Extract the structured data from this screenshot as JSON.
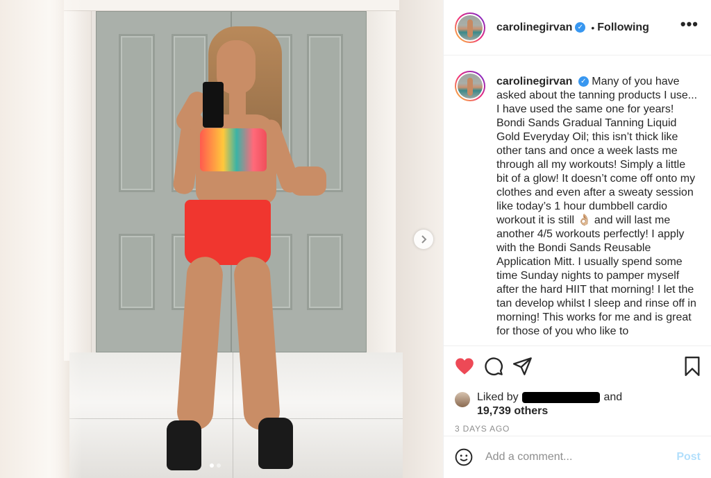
{
  "post": {
    "username": "carolinegirvan",
    "follow_sep": "•",
    "follow_status": "Following",
    "more_label": "•••",
    "caption": "Many of you have asked about the tanning products I use... I have used the same one for years! Bondi Sands Gradual Tanning Liquid Gold Everyday Oil; this isn’t thick like other tans and once a week lasts me through all my workouts! Simply a little bit of a glow! It doesn’t come off onto my clothes and even after a sweaty session like today’s 1 hour dumbbell cardio workout it is still 👌🏼 and will last me another 4/5 workouts perfectly! I apply with the Bondi Sands Reusable Application Mitt. I usually spend some time Sunday nights to pamper myself after the hard HIIT that morning! I let the tan develop whilst I sleep and rinse off in morning! This works for me and is great for those of you who like to"
  },
  "likes": {
    "prefix": "Liked by",
    "suffix": "and",
    "count": "19,739 others"
  },
  "timestamp": "3 DAYS AGO",
  "comment": {
    "placeholder": "Add a comment...",
    "post_label": "Post"
  },
  "carousel": {
    "total": 2,
    "current": 1
  },
  "icons": [
    "heart-icon",
    "comment-icon",
    "share-icon",
    "bookmark-icon",
    "emoji-icon",
    "chevron-right-icon",
    "verified-badge-icon"
  ],
  "colors": {
    "heart": "#ed4956",
    "verified": "#3897f0",
    "post_disabled": "#b2dffc",
    "muted": "#8e8e8e"
  }
}
